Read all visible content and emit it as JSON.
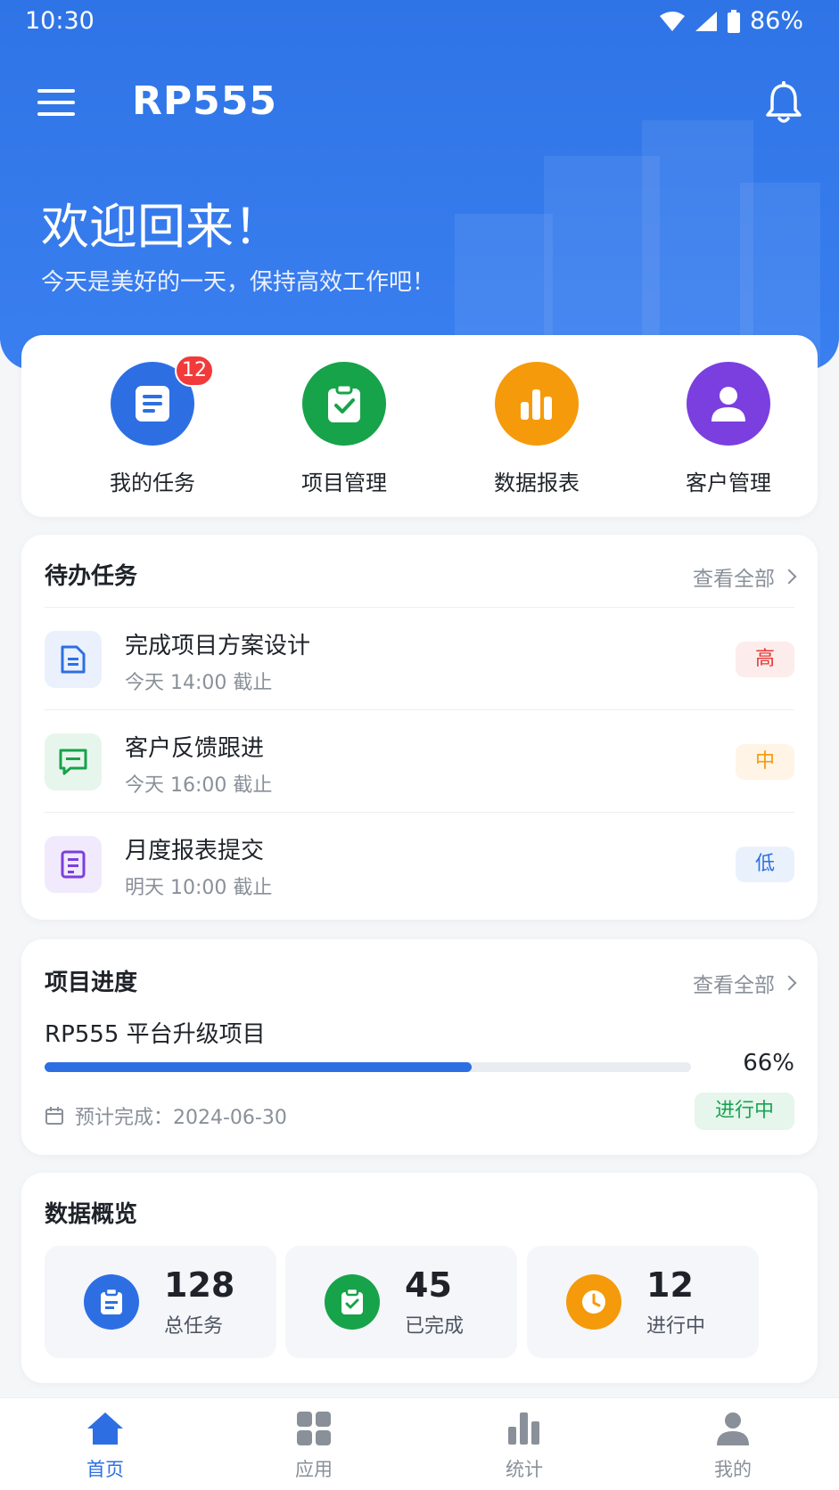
{
  "status_bar": {
    "time": "10:30",
    "battery": "86%"
  },
  "app_bar": {
    "title": "RP555"
  },
  "hero": {
    "welcome": "欢迎回来！",
    "subtitle": "今天是美好的一天，保持高效工作吧！"
  },
  "quick_actions": [
    {
      "label": "我的任务",
      "icon": "document-icon",
      "color": "#2d6fe3",
      "badge": "12"
    },
    {
      "label": "项目管理",
      "icon": "clipboard-check-icon",
      "color": "#17a34a"
    },
    {
      "label": "数据报表",
      "icon": "bar-chart-icon",
      "color": "#f59a0b"
    },
    {
      "label": "客户管理",
      "icon": "person-icon",
      "color": "#7b3fe0"
    }
  ],
  "todo": {
    "title": "待办任务",
    "view_all": "查看全部",
    "tasks": [
      {
        "title": "完成项目方案设计",
        "due": "今天 14:00 截止",
        "priority": "高",
        "icon": "document-icon"
      },
      {
        "title": "客户反馈跟进",
        "due": "今天 16:00 截止",
        "priority": "中",
        "icon": "chat-icon"
      },
      {
        "title": "月度报表提交",
        "due": "明天 10:00 截止",
        "priority": "低",
        "icon": "report-icon"
      }
    ]
  },
  "project_progress": {
    "title": "项目进度",
    "view_all": "查看全部",
    "project_name": "RP555 平台升级项目",
    "progress": 66,
    "progress_text": "66%",
    "due": "预计完成：2024-06-30",
    "status": "进行中"
  },
  "overview": {
    "title": "数据概览",
    "stats": [
      {
        "value": "128",
        "label": "总任务",
        "icon": "clipboard-icon",
        "color": "#2d6fe3"
      },
      {
        "value": "45",
        "label": "已完成",
        "icon": "clipboard-check-icon",
        "color": "#17a34a"
      },
      {
        "value": "12",
        "label": "进行中",
        "icon": "clock-icon",
        "color": "#f59a0b"
      }
    ]
  },
  "tabs": [
    {
      "label": "首页",
      "icon": "home-icon",
      "active": true
    },
    {
      "label": "应用",
      "icon": "grid-icon",
      "active": false
    },
    {
      "label": "统计",
      "icon": "bar-chart-icon",
      "active": false
    },
    {
      "label": "我的",
      "icon": "person-icon",
      "active": false
    }
  ]
}
